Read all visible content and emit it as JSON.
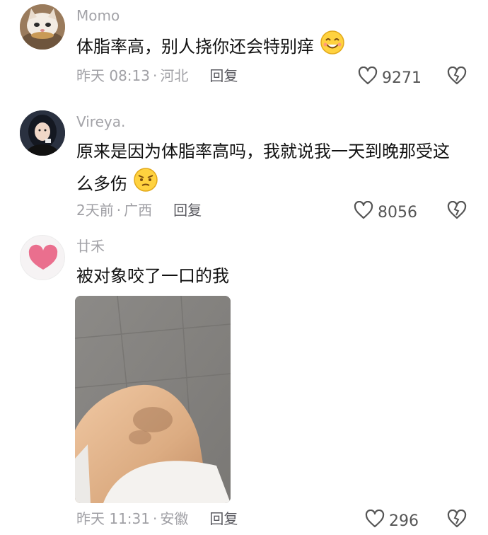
{
  "comments": [
    {
      "username": "Momo",
      "text": "体脂率高，别人挠你还会特别痒",
      "emoji": "smile-emoji",
      "time": "昨天 08:13",
      "location": "河北",
      "reply_label": "回复",
      "likes": "9271"
    },
    {
      "username": "Vireya.",
      "text": "原来是因为体脂率高吗，我就说我一天到晚那受这么多伤",
      "emoji": "annoyed-emoji",
      "time": "2天前",
      "location": "广西",
      "reply_label": "回复",
      "likes": "8056"
    },
    {
      "username": "廿禾",
      "text": "被对象咬了一口的我",
      "time": "昨天 11:31",
      "location": "安徽",
      "reply_label": "回复",
      "likes": "296"
    }
  ],
  "separator": "·",
  "icons": {
    "like": "heart-outline-icon",
    "dislike": "broken-heart-icon"
  },
  "colors": {
    "meta_text": "#a0a0a5",
    "username": "#a3a3a8",
    "reply": "#5a5a60"
  }
}
